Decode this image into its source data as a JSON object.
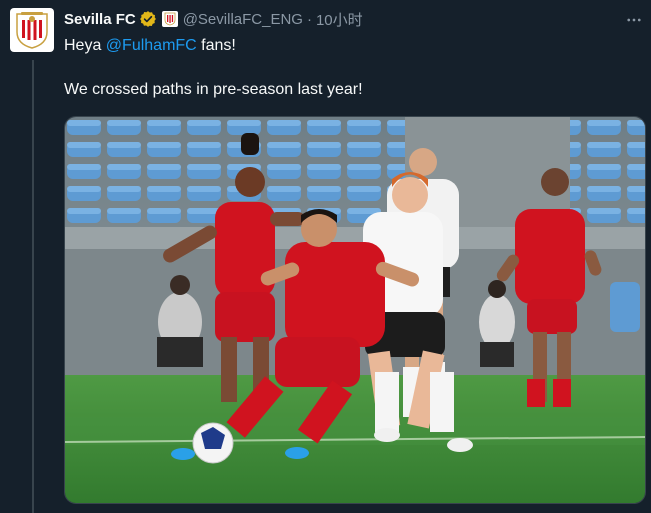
{
  "tweet": {
    "display_name": "Sevilla FC",
    "handle": "@SevillaFC_ENG",
    "separator": "·",
    "time": "10小时",
    "verified_icon": "gold-verified-badge-icon",
    "affiliation_icon": "sevilla-crest-icon",
    "more_icon": "more-horizontal-icon",
    "text_prefix": "Heya ",
    "mention": "@FulhamFC",
    "text_suffix": " fans!",
    "body_line": "We crossed paths in pre-season last year!"
  },
  "colors": {
    "background": "#15202b",
    "text": "#f7f9f9",
    "secondary_text": "#8b98a5",
    "link": "#1d9bf0",
    "verified_gold": "#e2b719",
    "sevilla_red": "#d0131f",
    "pitch_green": "#3f8f3a"
  },
  "media": {
    "kind": "photo",
    "subject": "football-match-photo"
  }
}
